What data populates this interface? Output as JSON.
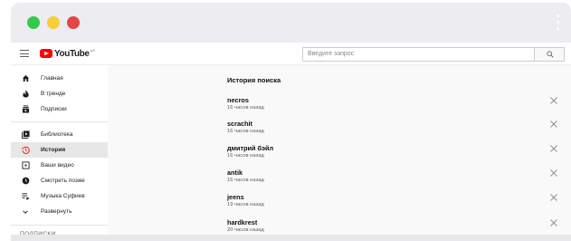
{
  "window": {
    "controls": [
      "green",
      "yellow",
      "red"
    ],
    "accent": "#ff0000"
  },
  "header": {
    "logo_text": "YouTube",
    "logo_region": "UA",
    "search_placeholder": "Введите запрос"
  },
  "sidebar": {
    "items": [
      {
        "label": "Главная",
        "icon": "home-icon"
      },
      {
        "label": "В тренде",
        "icon": "flame-icon"
      },
      {
        "label": "Подписки",
        "icon": "subscriptions-icon"
      },
      {
        "label": "Библиотека",
        "icon": "library-icon"
      },
      {
        "label": "История",
        "icon": "history-icon",
        "active": true
      },
      {
        "label": "Ваши видео",
        "icon": "your-videos-icon"
      },
      {
        "label": "Смотреть позже",
        "icon": "clock-icon"
      },
      {
        "label": "Музыка Суфиев",
        "icon": "playlist-icon"
      },
      {
        "label": "Развернуть",
        "icon": "chevron-down-icon"
      }
    ],
    "section_label": "ПОДПИСКИ"
  },
  "main": {
    "title": "История поиска",
    "entries": [
      {
        "query": "necros",
        "time": "16 часов назад"
      },
      {
        "query": "scrachit",
        "time": "16 часов назад"
      },
      {
        "query": "дмитрий бэйл",
        "time": "16 часов назад"
      },
      {
        "query": "antik",
        "time": "16 часов назад"
      },
      {
        "query": "jeens",
        "time": "19 часов назад"
      },
      {
        "query": "hardkrest",
        "time": "20 часов назад"
      }
    ]
  }
}
